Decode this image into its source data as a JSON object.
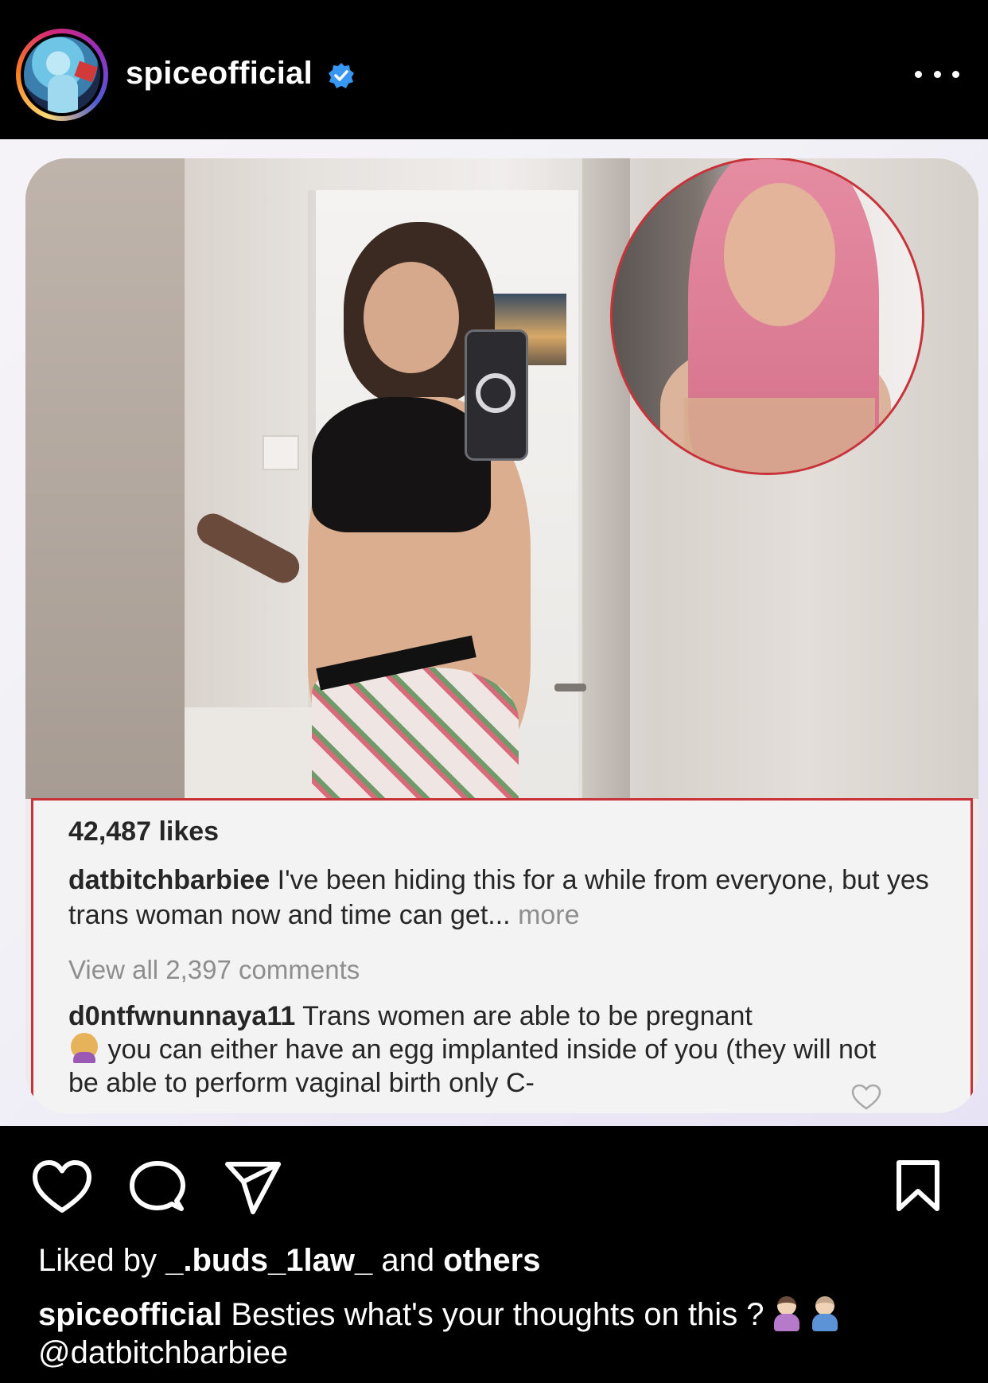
{
  "header": {
    "username": "spiceofficial",
    "verified": true,
    "avatar_icon": "profile-avatar",
    "more_icon": "more-dots-icon"
  },
  "embedded_post": {
    "likes": "42,487 likes",
    "caption_user": "datbitchbarbiee",
    "caption_text": " I've been hiding this for a while from everyone, but yes trans woman now and time can get...",
    "caption_more": " more",
    "view_comments": "View all 2,397 comments",
    "comment_user": "d0ntfwnunnaya11",
    "comment_text_1": " Trans women are able to be pregnant",
    "comment_text_2": " you can either have an egg implanted inside of you (they will not be able to perform vaginal birth only C-",
    "comment_emoji": "woman-facepalming-emoji"
  },
  "actions": {
    "like_icon": "heart-icon",
    "comment_icon": "comment-bubble-icon",
    "share_icon": "paper-plane-icon",
    "save_icon": "bookmark-icon"
  },
  "likes_line": {
    "prefix": "Liked by ",
    "user": "_.buds_1law_",
    "middle": " and ",
    "suffix": "others"
  },
  "caption": {
    "user": "spiceofficial",
    "text": " Besties what's your thoughts on this ?",
    "emojis": [
      "pregnant-woman-emoji",
      "pregnant-man-emoji"
    ],
    "mention": "@datbitchbarbiee"
  },
  "colors": {
    "background": "#000000",
    "verified_blue": "#3897f0",
    "highlight_red": "#c8333a"
  }
}
